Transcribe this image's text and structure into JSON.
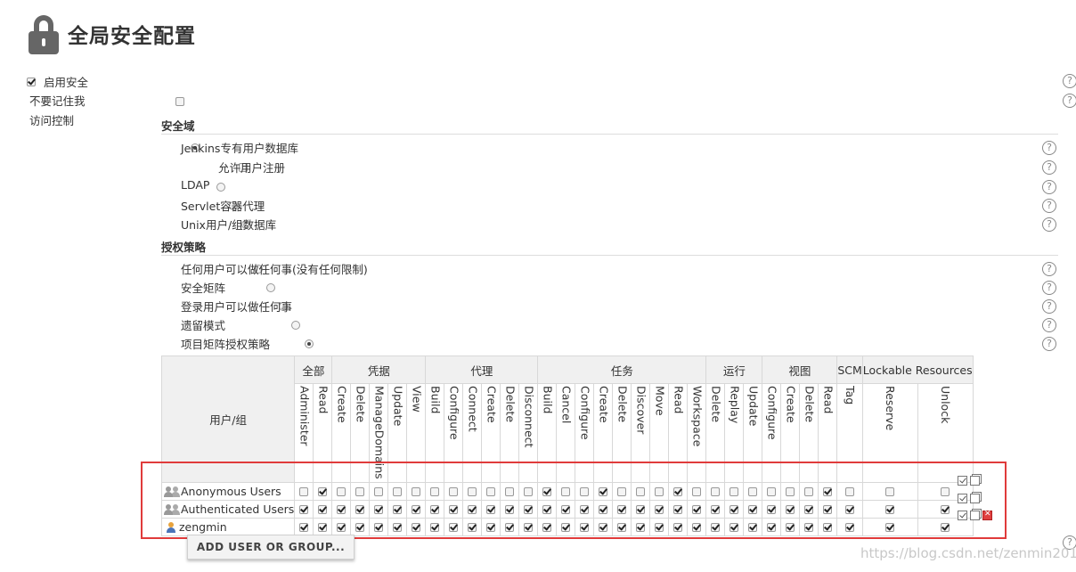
{
  "page": {
    "title": "全局安全配置",
    "lock_icon": "lock-icon"
  },
  "security": {
    "enable_security_label": "启用安全",
    "enable_security_checked": true,
    "dont_remember_label": "不要记住我",
    "dont_remember_checked": false,
    "access_control_label": "访问控制"
  },
  "realm": {
    "heading": "安全域",
    "options": [
      {
        "label": "Jenkins专有用户数据库",
        "selected": true
      },
      {
        "label": "LDAP",
        "selected": false
      },
      {
        "label": "Servlet容器代理",
        "selected": false
      },
      {
        "label": "Unix用户/组数据库",
        "selected": false
      }
    ],
    "allow_signup_label": "允许用户注册",
    "allow_signup_checked": false
  },
  "authorization": {
    "heading": "授权策略",
    "options": [
      {
        "label": "任何用户可以做任何事(没有任何限制)",
        "selected": false
      },
      {
        "label": "安全矩阵",
        "selected": false
      },
      {
        "label": "登录用户可以做任何事",
        "selected": false
      },
      {
        "label": "遗留模式",
        "selected": false
      },
      {
        "label": "项目矩阵授权策略",
        "selected": true
      }
    ]
  },
  "matrix": {
    "user_group_header": "用户/组",
    "groups": [
      {
        "label": "全部",
        "span": 2
      },
      {
        "label": "凭据",
        "span": 5
      },
      {
        "label": "代理",
        "span": 6
      },
      {
        "label": "任务",
        "span": 9
      },
      {
        "label": "运行",
        "span": 3
      },
      {
        "label": "视图",
        "span": 4
      },
      {
        "label": "SCM",
        "span": 1
      },
      {
        "label": "Lockable Resources",
        "span": 2
      }
    ],
    "permissions": [
      "Administer",
      "Read",
      "Create",
      "Delete",
      "ManageDomains",
      "Update",
      "View",
      "Build",
      "Configure",
      "Connect",
      "Create",
      "Delete",
      "Disconnect",
      "Build",
      "Cancel",
      "Configure",
      "Create",
      "Delete",
      "Discover",
      "Move",
      "Read",
      "Workspace",
      "Delete",
      "Replay",
      "Update",
      "Configure",
      "Create",
      "Delete",
      "Read",
      "Tag",
      "Reserve",
      "Unlock"
    ],
    "rows": [
      {
        "name": "Anonymous Users",
        "kind": "group",
        "perms": [
          0,
          1,
          0,
          0,
          0,
          0,
          0,
          0,
          0,
          0,
          0,
          0,
          0,
          1,
          0,
          0,
          1,
          0,
          0,
          0,
          1,
          0,
          0,
          0,
          0,
          0,
          0,
          0,
          1,
          0,
          0,
          0
        ],
        "can_delete": false
      },
      {
        "name": "Authenticated Users",
        "kind": "group",
        "perms": [
          1,
          1,
          1,
          1,
          1,
          1,
          1,
          1,
          1,
          1,
          1,
          1,
          1,
          1,
          1,
          1,
          1,
          1,
          1,
          1,
          1,
          1,
          1,
          1,
          1,
          1,
          1,
          1,
          1,
          1,
          1,
          1
        ],
        "can_delete": false
      },
      {
        "name": "zengmin",
        "kind": "user",
        "perms": [
          1,
          1,
          1,
          1,
          1,
          1,
          1,
          1,
          1,
          1,
          1,
          1,
          1,
          1,
          1,
          1,
          1,
          1,
          1,
          1,
          1,
          1,
          1,
          1,
          1,
          1,
          1,
          1,
          1,
          1,
          1,
          1
        ],
        "can_delete": true
      }
    ],
    "add_button_label": "ADD USER OR GROUP..."
  },
  "watermark": "https://blog.csdn.net/zenmin2015",
  "icons": {
    "help": "help-icon",
    "group": "group-icon",
    "user": "user-icon",
    "toggle_all": "toggle-all-icon",
    "copy": "copy-icon",
    "delete": "delete-icon"
  },
  "colors": {
    "highlight_box": "#e03b3b",
    "header_bg": "#f0f0f0"
  }
}
